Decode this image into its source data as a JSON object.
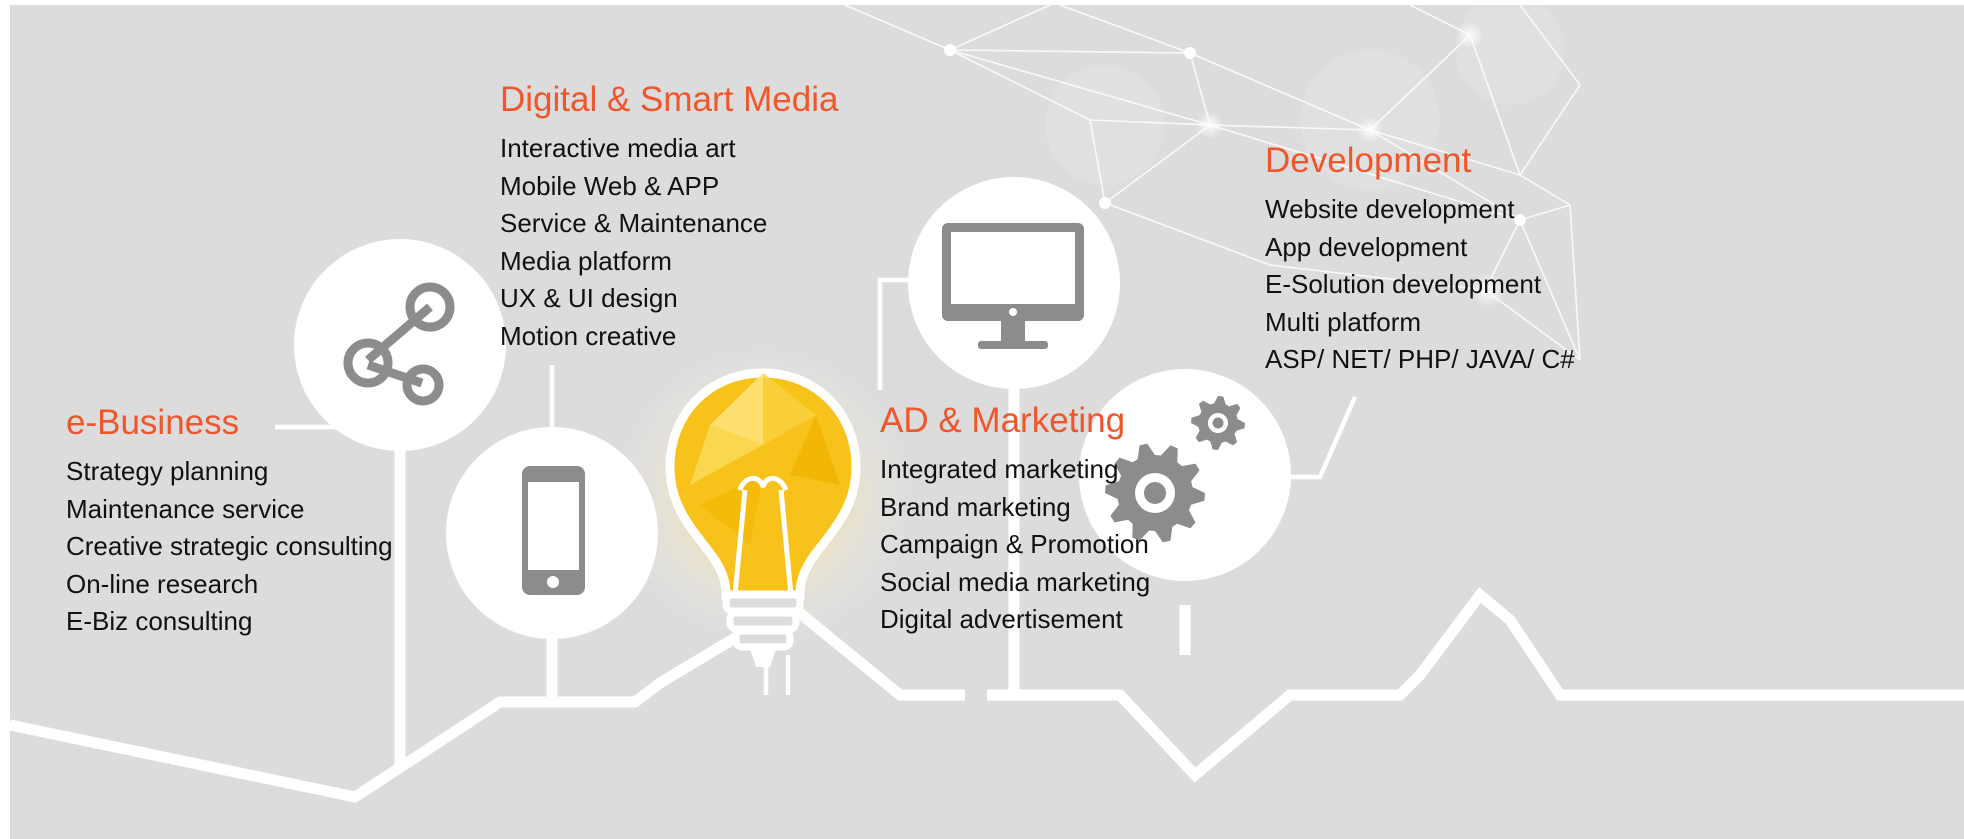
{
  "colors": {
    "background": "#dcdcdc",
    "accent": "#f0562c",
    "line": "#ffffff",
    "icon": "#8c8c8c",
    "bulb": "#f7c21a"
  },
  "sections": {
    "ebusiness": {
      "title": "e-Business",
      "icon": "share-icon",
      "items": [
        "Strategy planning",
        "Maintenance service",
        "Creative strategic consulting",
        "On-line research",
        "E-Biz consulting"
      ]
    },
    "digital": {
      "title": "Digital & Smart Media",
      "icon": "smartphone-icon",
      "items": [
        "Interactive media art",
        "Mobile Web & APP",
        "Service & Maintenance",
        "Media platform",
        "UX & UI design",
        "Motion creative"
      ]
    },
    "ad": {
      "title": "AD & Marketing",
      "icon": "monitor-icon",
      "items": [
        "Integrated marketing",
        "Brand marketing",
        "Campaign & Promotion",
        "Social media marketing",
        "Digital advertisement"
      ]
    },
    "development": {
      "title": "Development",
      "icon": "gears-icon",
      "items": [
        "Website development",
        "App development",
        "E-Solution development",
        "Multi platform",
        "ASP/ NET/ PHP/ JAVA/ C#"
      ]
    }
  },
  "center_icon": "lightbulb-icon"
}
